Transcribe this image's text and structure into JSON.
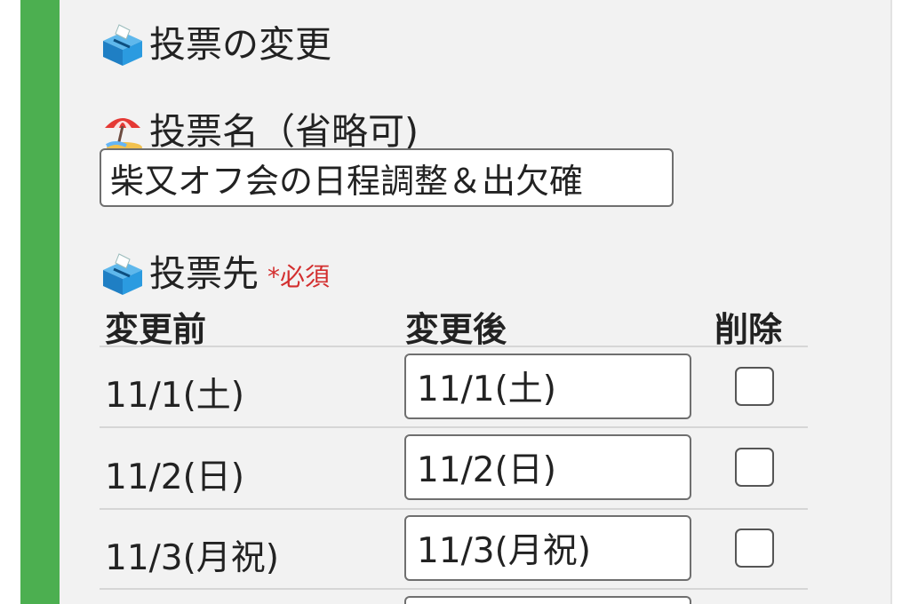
{
  "section": {
    "title": "投票の変更",
    "title_icon": "ballot-box-icon"
  },
  "poll_name": {
    "label": "投票名（省略可)",
    "label_icon": "beach-umbrella-icon",
    "value": "柴又オフ会の日程調整＆出欠確"
  },
  "destinations": {
    "label": "投票先",
    "label_icon": "ballot-box-icon",
    "required": "*必須",
    "columns": {
      "before": "変更前",
      "after": "変更後",
      "delete": "削除"
    },
    "rows": [
      {
        "before": "11/1(土)",
        "after": "11/1(土)",
        "delete": false
      },
      {
        "before": "11/2(日)",
        "after": "11/2(日)",
        "delete": false
      },
      {
        "before": "11/3(月祝)",
        "after": "11/3(月祝)",
        "delete": false
      }
    ]
  },
  "colors": {
    "accent_bar": "#4caf50",
    "panel_bg": "#f2f2f2",
    "required_text": "#d32f2f"
  }
}
